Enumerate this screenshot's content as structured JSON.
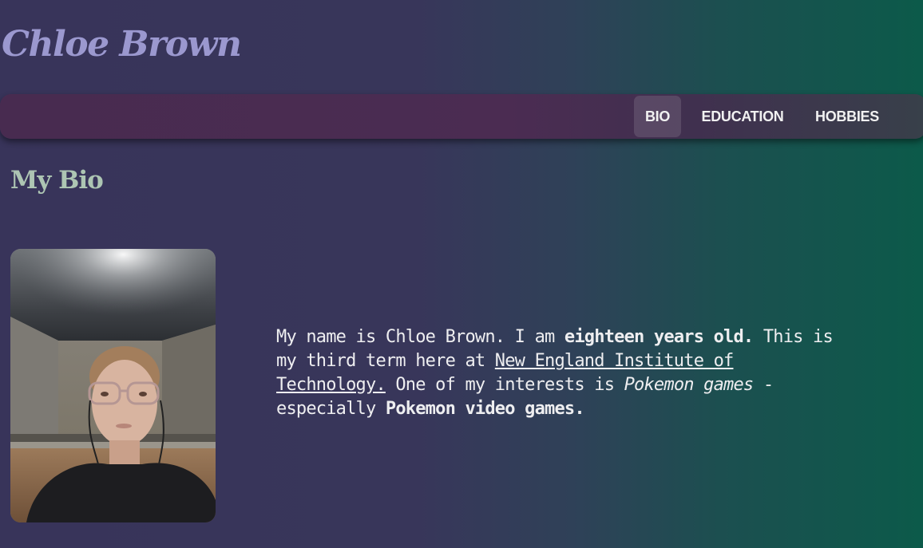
{
  "header": {
    "site_title": "Chloe Brown"
  },
  "nav": {
    "items": [
      {
        "label": "BIO",
        "active": true
      },
      {
        "label": "EDUCATION",
        "active": false
      },
      {
        "label": "HOBBIES",
        "active": false
      }
    ]
  },
  "main": {
    "section_title": "My Bio",
    "photo": {
      "icon": "profile-photo"
    },
    "bio": {
      "part1": "My name is Chloe Brown. I am ",
      "bold1": "eighteen years old.",
      "part2": " This is my third term here at ",
      "link": "New England Institute of Technology.",
      "part3": " One of my interests is ",
      "italic": "Pokemon games",
      "part4": " - especially ",
      "bold2": "Pokemon video games."
    }
  },
  "colors": {
    "title": "#9b98cf",
    "section_title": "#adc5b3",
    "navbar": "#4b2c52",
    "background_left": "#38345a",
    "background_right": "#0c5a4a"
  }
}
